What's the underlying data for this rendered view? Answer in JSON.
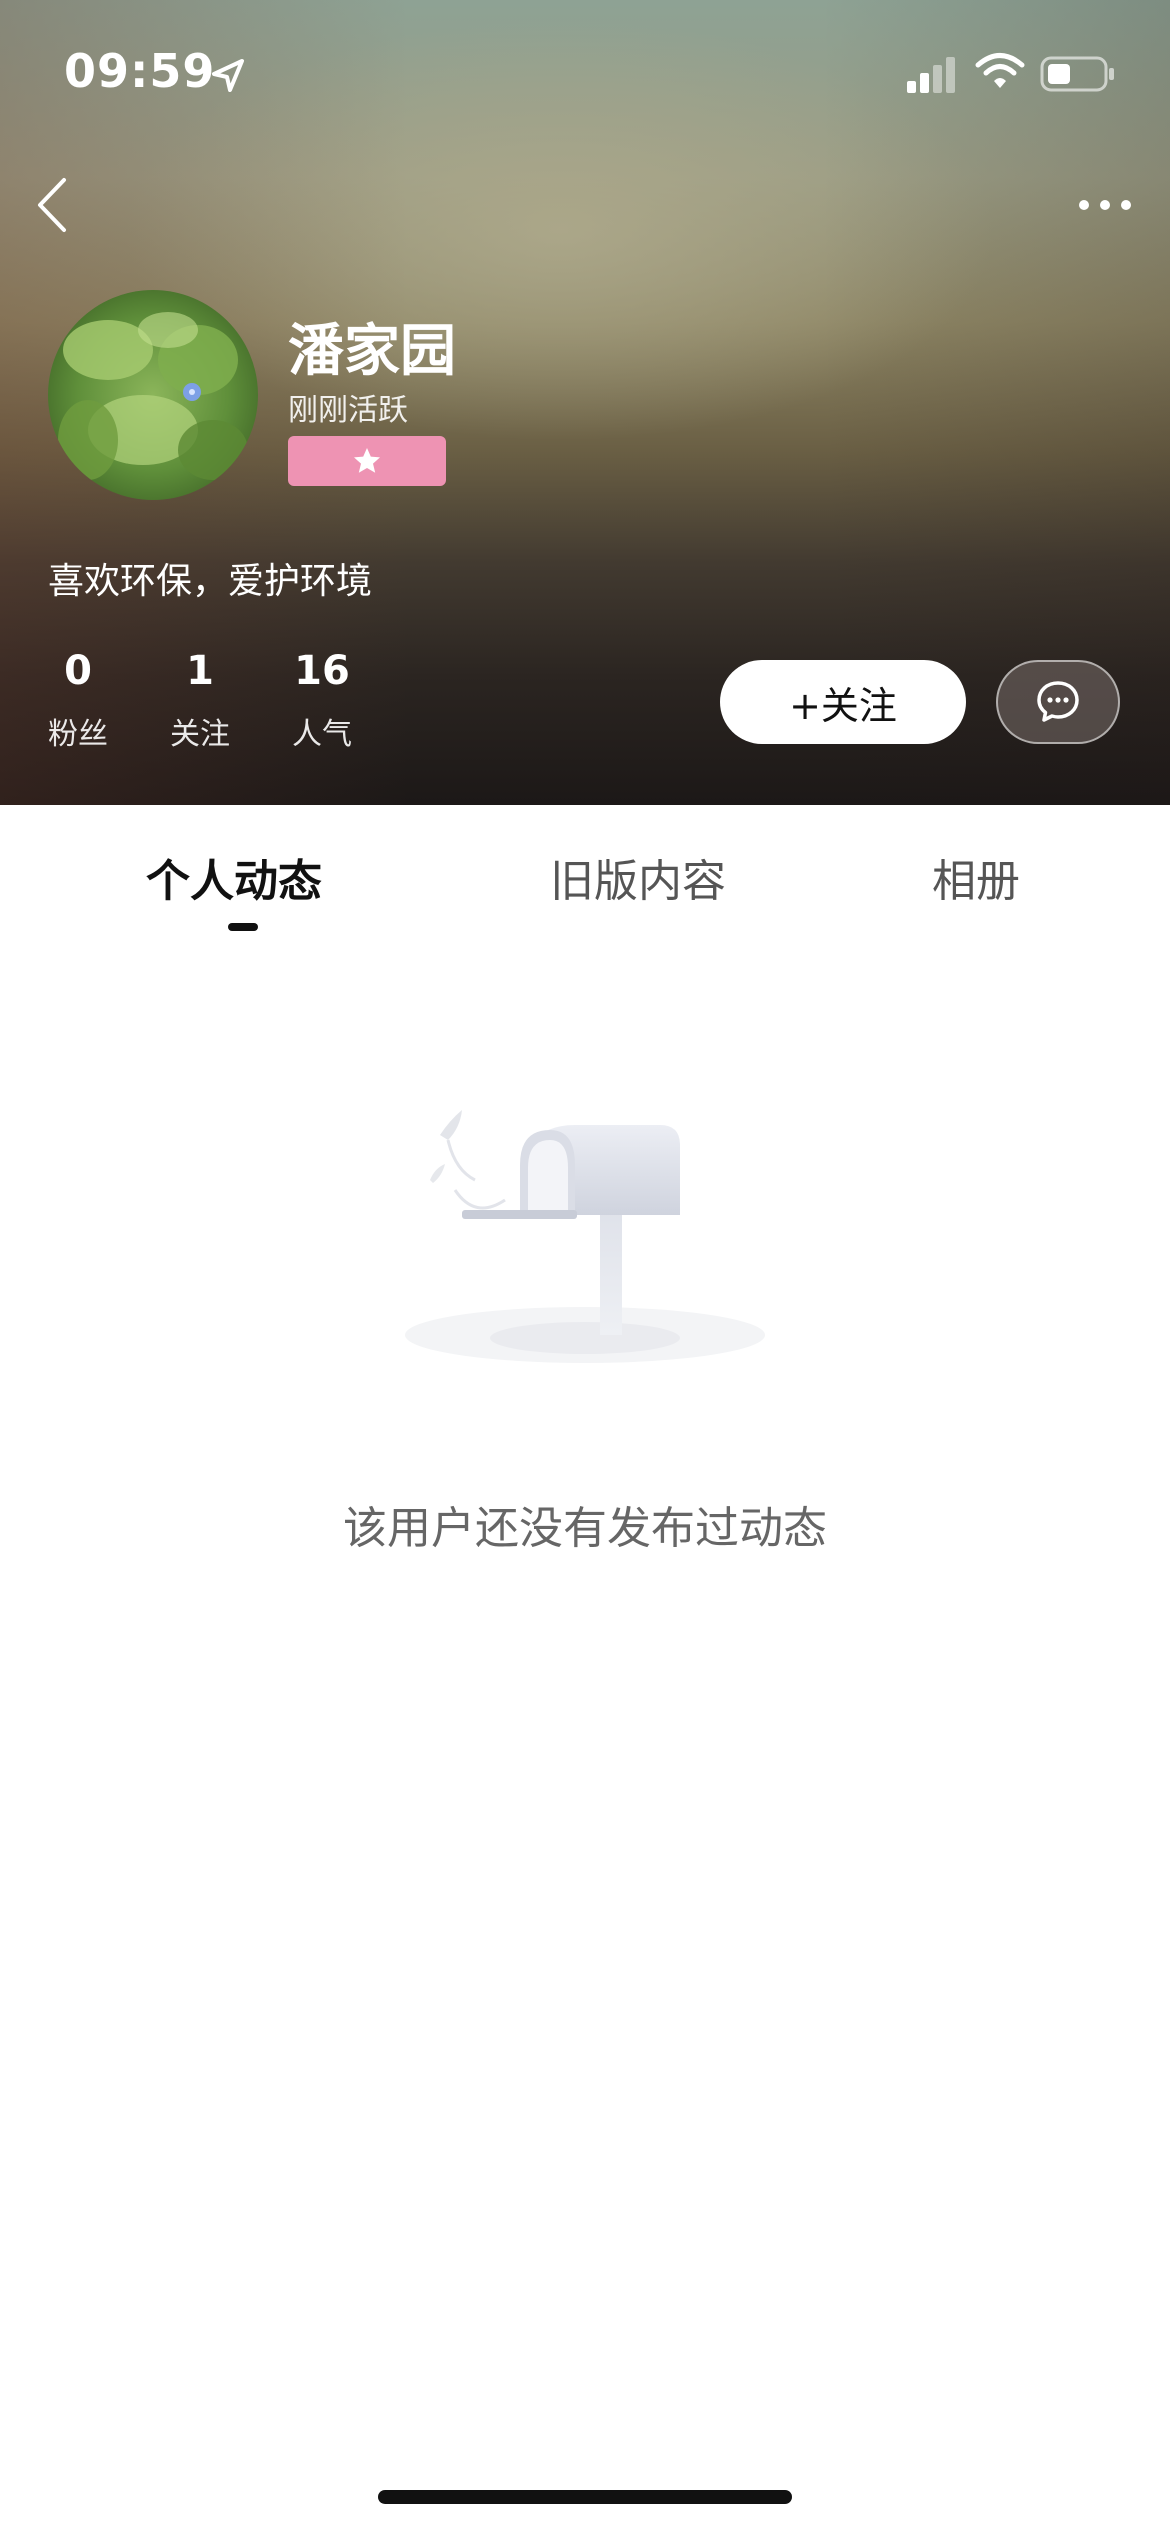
{
  "status_bar": {
    "time": "09:59"
  },
  "profile": {
    "username": "潘家园",
    "active_status": "刚刚活跃",
    "bio": "喜欢环保，爱护环境",
    "badge_color": "#ee93b3",
    "stats": [
      {
        "value": "0",
        "label": "粉丝"
      },
      {
        "value": "1",
        "label": "关注"
      },
      {
        "value": "16",
        "label": "人气"
      }
    ],
    "follow_label": "+关注"
  },
  "tabs": [
    {
      "label": "个人动态",
      "active": true
    },
    {
      "label": "旧版内容",
      "active": false
    },
    {
      "label": "相册",
      "active": false
    }
  ],
  "empty_state": {
    "message": "该用户还没有发布过动态",
    "icon": "mailbox-icon"
  },
  "icons": {
    "back": "back-icon",
    "more": "more-icon",
    "message": "message-icon",
    "badge": "star-icon"
  }
}
